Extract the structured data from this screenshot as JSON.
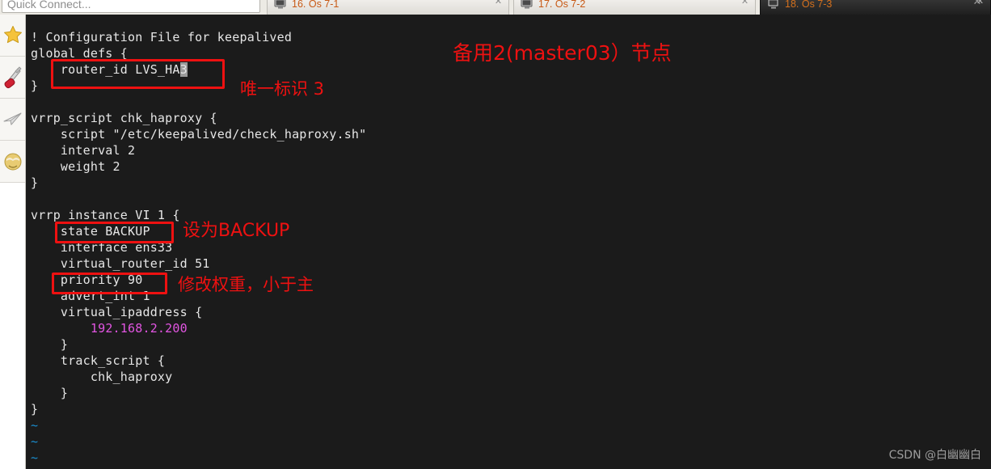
{
  "window": {
    "close_label": "✕",
    "quick_connect": {
      "placeholder": "Quick Connect...",
      "value": "Quick Connect..."
    },
    "shield_icon": "shield-icon"
  },
  "tabs": [
    {
      "label": "16. Os 7-1",
      "close": "✕",
      "active": false,
      "icon": "monitor-icon"
    },
    {
      "label": "17. Os 7-2",
      "close": "✕",
      "active": false,
      "icon": "monitor-icon"
    },
    {
      "label": "18. Os 7-3",
      "close": "✕",
      "active": true,
      "icon": "monitor-icon"
    }
  ],
  "sidebar": {
    "items": [
      {
        "name": "favorites",
        "icon": "star-icon"
      },
      {
        "name": "tools",
        "icon": "swiss-army-knife-icon"
      },
      {
        "name": "send",
        "icon": "paper-plane-icon"
      },
      {
        "name": "profile",
        "icon": "smiley-face-icon"
      }
    ]
  },
  "terminal": {
    "lines": [
      "! Configuration File for keepalived",
      "global_defs {",
      "    router_id LVS_HA3",
      "}",
      "",
      "vrrp_script chk_haproxy {",
      "    script \"/etc/keepalived/check_haproxy.sh\"",
      "    interval 2",
      "    weight 2",
      "}",
      "",
      "vrrp_instance VI_1 {",
      "    state BACKUP",
      "    interface ens33",
      "    virtual_router_id 51",
      "    priority 90",
      "    advert_int 1",
      "    virtual_ipaddress {",
      "        192.168.2.200",
      "    }",
      "    track_script {",
      "        chk_haproxy",
      "    }",
      "}",
      "~",
      "~",
      "~"
    ],
    "cursor_char": "3",
    "ip_value": "192.168.2.200",
    "empty_marker": "~",
    "colors": {
      "background": "#1b1b1b",
      "foreground": "#e6e6e6",
      "ip": "#e255e2",
      "tilde": "#1a8fd1",
      "cursor": "#9a9a9a"
    }
  },
  "annotations": {
    "color": "#ee1111",
    "items": [
      {
        "name": "node-role-note",
        "text": "备用2(master03）节点",
        "size": 25
      },
      {
        "name": "router-id-note",
        "text": "唯一标识 3",
        "size": 21
      },
      {
        "name": "state-note",
        "text": "设为BACKUP",
        "size": 22
      },
      {
        "name": "priority-note",
        "text": "修改权重，小于主",
        "size": 21
      }
    ]
  },
  "watermark": {
    "text": "CSDN @白幽幽白"
  }
}
